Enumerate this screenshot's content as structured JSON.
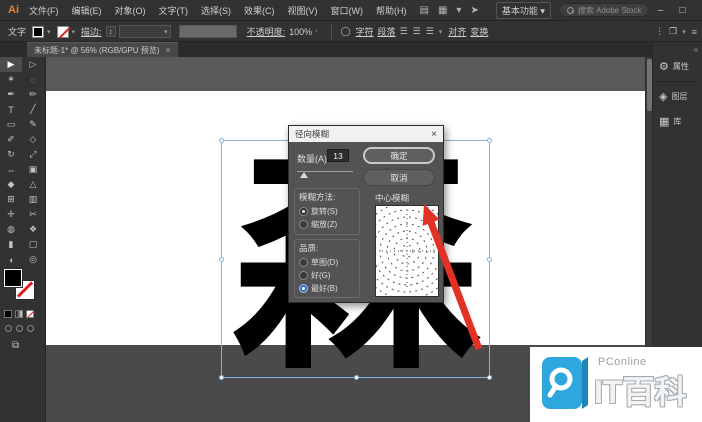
{
  "titlebar": {
    "app_badge": "Ai",
    "menus": [
      {
        "label": "文件(F)"
      },
      {
        "label": "编辑(E)"
      },
      {
        "label": "对象(O)"
      },
      {
        "label": "文字(T)"
      },
      {
        "label": "选择(S)"
      },
      {
        "label": "效果(C)"
      },
      {
        "label": "视图(V)"
      },
      {
        "label": "窗口(W)"
      },
      {
        "label": "帮助(H)"
      }
    ],
    "icons": {
      "arrange_glyph": "▤",
      "layout_glyph": "▦",
      "chevron_glyph": "▾",
      "share_glyph": "➤"
    },
    "workspace": {
      "label": "基本功能",
      "chevron": "▾"
    },
    "search": {
      "placeholder": "搜索 Adobe Stock"
    },
    "window_controls": {
      "minimize": "–",
      "maximize": "□",
      "close": "×"
    }
  },
  "options_bar": {
    "context_label": "文字",
    "stroke_label": "描边:",
    "stepper_glyph": "↕",
    "swatch_chevron": "▾",
    "opacity_label": "不透明度:",
    "opacity_value": "100%",
    "opacity_chevron": "›",
    "style_circle_glyph": "◯",
    "character_link": "字符",
    "paragraph_link": "段落",
    "align_left_glyph": "☰",
    "align_center_glyph": "☰",
    "align_right_glyph": "☰",
    "extra_chevron": "▾",
    "align_link": "对齐",
    "transform_link": "变换",
    "more_glyph": "⋮",
    "panel_glyph": "❐",
    "menu_glyph": "≡"
  },
  "document_tab": {
    "title": "未标题-1* @ 56% (RGB/GPU 预览)",
    "close": "×"
  },
  "toolbar": {
    "tools": [
      {
        "name": "selection-tool",
        "glyph": "▶"
      },
      {
        "name": "direct-selection-tool",
        "glyph": "▷"
      },
      {
        "name": "magic-wand-tool",
        "glyph": "✶"
      },
      {
        "name": "lasso-tool",
        "glyph": "◌"
      },
      {
        "name": "pen-tool",
        "glyph": "✒"
      },
      {
        "name": "curvature-tool",
        "glyph": "✏"
      },
      {
        "name": "type-tool",
        "glyph": "T"
      },
      {
        "name": "line-segment-tool",
        "glyph": "╱"
      },
      {
        "name": "rectangle-tool",
        "glyph": "▭"
      },
      {
        "name": "paintbrush-tool",
        "glyph": "✎"
      },
      {
        "name": "pencil-tool",
        "glyph": "✐"
      },
      {
        "name": "shaper-tool",
        "glyph": "◇"
      },
      {
        "name": "rotate-tool",
        "glyph": "↻"
      },
      {
        "name": "scale-tool",
        "glyph": "⤢"
      },
      {
        "name": "width-tool",
        "glyph": "⇔"
      },
      {
        "name": "free-transform-tool",
        "glyph": "▣"
      },
      {
        "name": "shape-builder-tool",
        "glyph": "◆"
      },
      {
        "name": "perspective-grid-tool",
        "glyph": "△"
      },
      {
        "name": "mesh-tool",
        "glyph": "⊞"
      },
      {
        "name": "gradient-tool",
        "glyph": "▥"
      },
      {
        "name": "eyedropper-tool",
        "glyph": "✛"
      },
      {
        "name": "scissors-tool",
        "glyph": "✂"
      },
      {
        "name": "blend-tool",
        "glyph": "◍"
      },
      {
        "name": "symbol-sprayer-tool",
        "glyph": "❖"
      },
      {
        "name": "column-graph-tool",
        "glyph": "▮"
      },
      {
        "name": "artboard-tool",
        "glyph": "▢"
      },
      {
        "name": "hand-tool",
        "glyph": "◖"
      },
      {
        "name": "zoom-tool",
        "glyph": "◎"
      }
    ],
    "screen_mode_glyph": "⧉"
  },
  "canvas": {
    "glyph": "森"
  },
  "dialog": {
    "title": "径向模糊",
    "close": "×",
    "amount_label": "数量(A)",
    "amount_value": "13",
    "ok_label": "确定",
    "cancel_label": "取消",
    "method_label": "模糊方法:",
    "method_options": [
      {
        "label": "旋转(S)",
        "selected": true
      },
      {
        "label": "缩放(Z)",
        "selected": false
      }
    ],
    "quality_label": "品质:",
    "quality_options": [
      {
        "label": "草图(D)",
        "selected": false
      },
      {
        "label": "好(G)",
        "selected": false
      },
      {
        "label": "最好(B)",
        "selected": true
      }
    ],
    "center_label": "中心模糊"
  },
  "right_dock": {
    "collapse_glyph": "«",
    "panels": [
      {
        "name": "properties-panel",
        "icon_glyph": "⚙",
        "label": "属性"
      },
      {
        "name": "layers-panel",
        "icon_glyph": "◈",
        "label": "图层"
      },
      {
        "name": "libraries-panel",
        "icon_glyph": "▦",
        "label": "库"
      }
    ]
  },
  "watermark": {
    "brand": "PConline",
    "title": "IT百科"
  },
  "colors": {
    "selection_blue": "#85b4e0",
    "arrow_red": "#e23226",
    "brand_blue": "#2ea7de",
    "dialog_body": "#535353",
    "artboard": "#ffffff"
  }
}
